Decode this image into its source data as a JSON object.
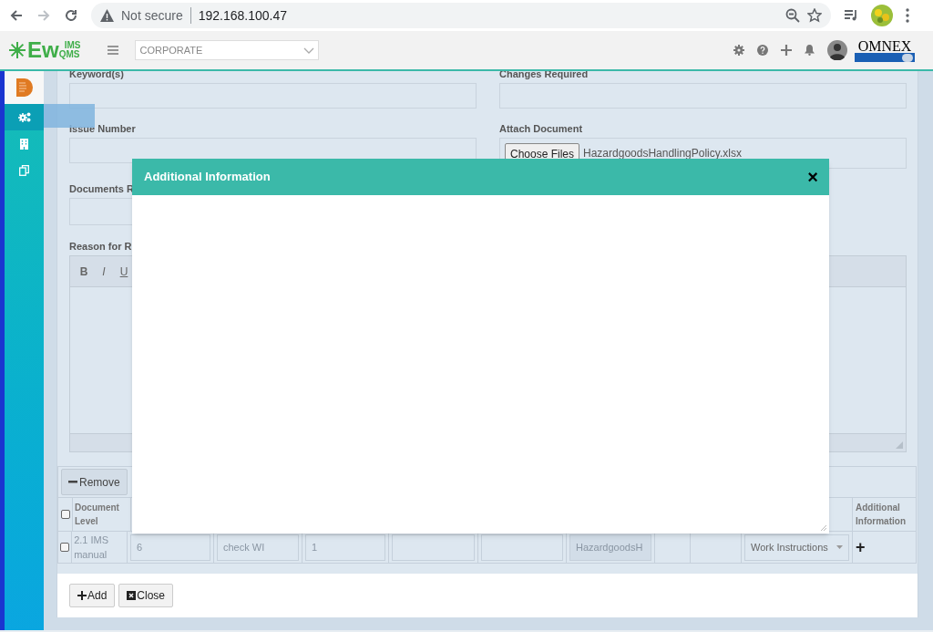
{
  "browser": {
    "security_label": "Not secure",
    "url": "192.168.100.47"
  },
  "header": {
    "logo": {
      "letters": "Ew",
      "top": "IMS",
      "bottom": "QMS"
    },
    "site_select": {
      "value": "CORPORATE"
    },
    "brand": "OMNEX"
  },
  "sidebar": {
    "items": [
      {
        "kind": "document",
        "selected": false
      },
      {
        "kind": "gears",
        "selected": true
      },
      {
        "kind": "building",
        "selected": false
      },
      {
        "kind": "copy",
        "selected": false
      }
    ]
  },
  "form": {
    "rows": [
      [
        {
          "label": "Keyword(s)",
          "kind": "text"
        },
        {
          "label": "Changes Required",
          "kind": "text"
        }
      ],
      [
        {
          "label": "Issue Number",
          "kind": "text"
        },
        {
          "label": "Attach Document",
          "kind": "file",
          "button": "Choose Files",
          "file": "HazardgoodsHandlingPolicy.xlsx"
        }
      ],
      [
        {
          "label": "Documents R",
          "kind": "text"
        }
      ]
    ],
    "editor": {
      "label": "Reason for R",
      "tools": [
        "B",
        "I",
        "U"
      ]
    }
  },
  "table": {
    "remove_button": "Remove",
    "header": {
      "checked": false,
      "first": "Document Level",
      "last": "Additional Information"
    },
    "rows": [
      {
        "checked": false,
        "document_level": "2.1 IMS manual",
        "cells": [
          {
            "kind": "input",
            "value": "6"
          },
          {
            "kind": "input",
            "value": "check WI"
          },
          {
            "kind": "input",
            "value": "1"
          },
          {
            "kind": "input"
          },
          {
            "kind": "input"
          },
          {
            "kind": "input",
            "value": "HazardgoodsH"
          },
          {
            "kind": "empty"
          },
          {
            "kind": "empty"
          },
          {
            "kind": "select",
            "value": "Work Instructions"
          },
          {
            "kind": "add",
            "value": "+"
          }
        ]
      }
    ]
  },
  "footer": {
    "buttons": [
      {
        "kind": "add",
        "label": "Add"
      },
      {
        "kind": "close",
        "label": "Close"
      }
    ]
  },
  "modal": {
    "title": "Additional Information",
    "close": "×"
  }
}
